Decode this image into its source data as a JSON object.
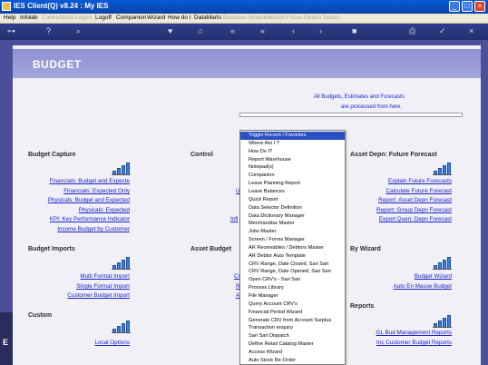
{
  "window": {
    "title": "IES Client(Q) v8.24 : My IES",
    "min": "_",
    "max": "□",
    "close": "×"
  },
  "menubar": [
    {
      "label": "Help",
      "enabled": true
    },
    {
      "label": "Infolab",
      "enabled": true
    },
    {
      "label": "Connections",
      "enabled": false
    },
    {
      "label": "Logon",
      "enabled": false
    },
    {
      "label": "Logoff",
      "enabled": true
    },
    {
      "label": "Companion",
      "enabled": true
    },
    {
      "label": "Wizard",
      "enabled": true
    },
    {
      "label": "How do I",
      "enabled": true
    },
    {
      "label": "DataMarts",
      "enabled": true
    },
    {
      "label": "Business Modules",
      "enabled": false
    },
    {
      "label": "Action Focus",
      "enabled": false
    },
    {
      "label": "Option Select",
      "enabled": false
    }
  ],
  "toolbar": {
    "icons": [
      "key-icon",
      "help-icon",
      "search-icon",
      "heart-icon",
      "home-icon",
      "back-icon",
      "forward-icon",
      "previous-icon",
      "next-icon",
      "stop-icon",
      "print-icon",
      "ok-icon",
      "exit-icon"
    ],
    "glyphs": [
      "⊶",
      "?",
      "⌕",
      "♥",
      "⌂",
      "«",
      "«",
      "‹",
      "›",
      "■",
      "⎙",
      "✓",
      "×"
    ]
  },
  "page": {
    "title": "BUDGET",
    "intro_line1": "All Budgets, Estimates and Forecasts",
    "intro_line2": "are processed from here."
  },
  "sections": {
    "budget_capture": {
      "title": "Budget Capture",
      "links": [
        "Financials: Budget and Expecte",
        "Financials: Expected Only",
        "Physicals: Budget and Expected",
        "Physicals: Expected",
        "KPI: Key Performance Indicator",
        "Income Budget by Customer"
      ]
    },
    "control": {
      "title": "Control",
      "links": [
        "U",
        "Infl"
      ]
    },
    "asset_depn": {
      "title": "Asset Depn: Future Forecast",
      "links": [
        "Explain Future Forecasts",
        "Calculate Future Forecast",
        "Report: Asset Depn Forecast",
        "Report: Group Depn Forecast",
        "Export Quen: Depn Forecast"
      ]
    },
    "budget_imports": {
      "title": "Budget Imports",
      "links": [
        "Multi Format Import",
        "Single Format Import",
        "Customer Budget Import"
      ]
    },
    "asset_budget": {
      "title": "Asset Budget",
      "links": [
        "Cr",
        "R",
        "A"
      ]
    },
    "by_wizard": {
      "title": "By Wizard",
      "links": [
        "Budget Wizard",
        "Auto En Masse Budget"
      ]
    },
    "custom": {
      "title": "Custom",
      "links": [
        "Local Options"
      ]
    },
    "reports": {
      "title": "Reports",
      "links": [
        "GL Bud Management Reports",
        "Inc Customer Budget Reports"
      ]
    }
  },
  "dock": {
    "label": "E"
  },
  "dropdown": {
    "items": [
      "Toggle Recent / Favorites",
      "Where Am I ?",
      "How Do I?",
      "Report Warehouse",
      "Notepad(s)",
      "Companion",
      "Leave Planning Report",
      "Leave Balances",
      "Quick Report",
      "Data Selector Definition",
      "Data Dictionary Manager",
      "Merchandise Master",
      "Jobs Master",
      "Screen / Forms Manager",
      "AR Receivables / Debtors Master",
      "AR Debtor Auto Template",
      "CRV Range, Date Closed, Sari Sari",
      "CRV Range, Date Opened, Sari Sari",
      "Open CRV's - Sari Sari",
      "Process Library",
      "File Manager",
      "Query Account CRV's",
      "Financial Period Wizard",
      "Generate CRV from Account Surplus",
      "Transaction enquiry",
      "Sari Sari Dispatch",
      "Define Retail Catalog Master",
      "Access Wizard",
      "Auto Stock Re-Order"
    ],
    "selected_index": 0
  }
}
